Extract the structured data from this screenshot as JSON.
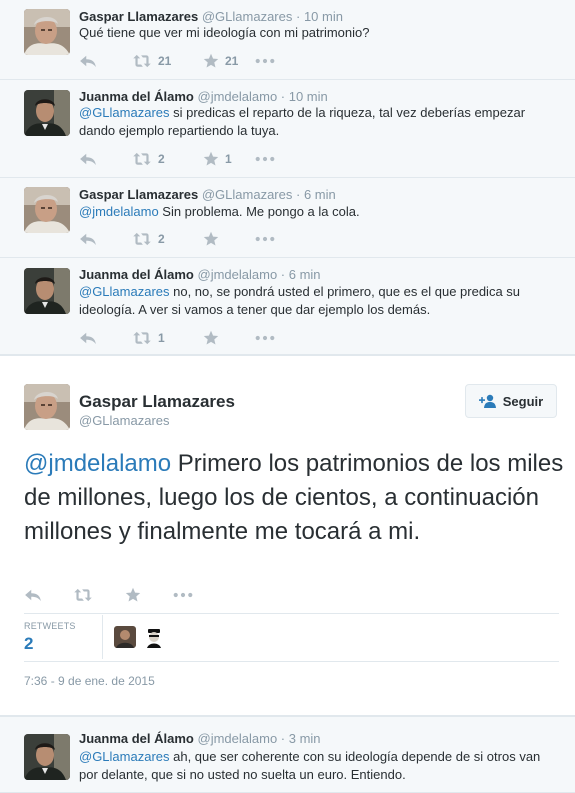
{
  "tweets": [
    {
      "name": "Gaspar Llamazares",
      "handle": "@GLlamazares",
      "time": "10 min",
      "mention": "",
      "text": "Qué tiene que ver mi ideología con mi patrimonio?",
      "retweets": "21",
      "favorites": "21"
    },
    {
      "name": "Juanma del Álamo",
      "handle": "@jmdelalamo",
      "time": "10 min",
      "mention": "@GLlamazares",
      "text": " si predicas el reparto de la riqueza, tal vez deberías empezar dando ejemplo repartiendo la tuya.",
      "retweets": "2",
      "favorites": "1"
    },
    {
      "name": "Gaspar Llamazares",
      "handle": "@GLlamazares",
      "time": "6 min",
      "mention": "@jmdelalamo",
      "text": " Sin problema. Me pongo a la cola.",
      "retweets": "2",
      "favorites": ""
    },
    {
      "name": "Juanma del Álamo",
      "handle": "@jmdelalamo",
      "time": "6 min",
      "mention": "@GLlamazares",
      "text": " no, no, se pondrá usted el primero, que es el que predica su ideología. A ver si vamos a tener que dar ejemplo los demás.",
      "retweets": "1",
      "favorites": ""
    }
  ],
  "separator": " · ",
  "focused": {
    "name": "Gaspar Llamazares",
    "handle": "@GLlamazares",
    "follow_label": "Seguir",
    "mention": "@jmdelalamo",
    "text": " Primero los patrimonios de los miles de millones, luego los de cientos, a continuación millones y finalmente me tocará a mi.",
    "retweets_label": "RETWEETS",
    "retweets_count": "2",
    "date": "7:36 - 9 de ene. de 2015"
  },
  "last_tweet": {
    "name": "Juanma del Álamo",
    "handle": "@jmdelalamo",
    "time": "3 min",
    "mention": "@GLlamazares",
    "text": " ah, que ser coherente con su ideología depende de si otros van por delante, que si no usted no suelta un euro. Entiendo."
  },
  "colors": {
    "link": "#2b7bb9",
    "muted": "#8899a6",
    "icon": "#b1bbc3",
    "background": "#f5f8fa"
  },
  "icons": [
    "reply-icon",
    "retweet-icon",
    "favorite-icon",
    "more-icon",
    "follow-person-icon"
  ]
}
